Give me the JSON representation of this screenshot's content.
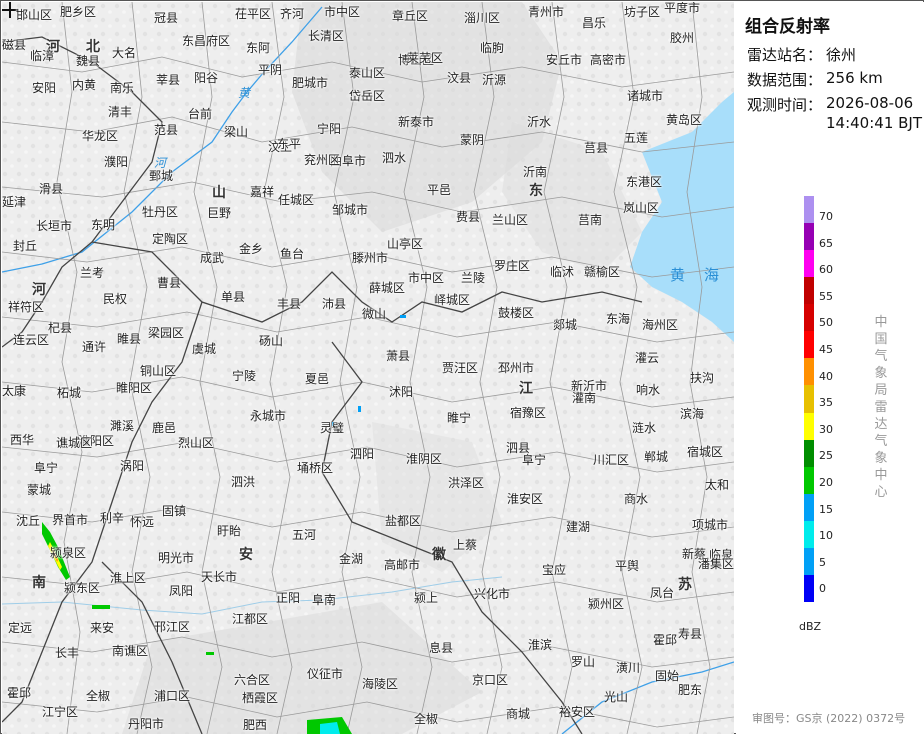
{
  "panel": {
    "title": "组合反射率",
    "station_label": "雷达站名：",
    "station_value": "徐州",
    "range_label": "数据范围：",
    "range_value": "256 km",
    "time_label": "观测时间：",
    "time_date": "2026-08-06",
    "time_clock": "14:40:41 BJT",
    "organization": "中国气象局雷达气象中心",
    "unit": "dBZ",
    "review_number": "审图号：GS京 (2022) 0372号"
  },
  "legend": {
    "ticks": [
      "70",
      "65",
      "60",
      "55",
      "50",
      "45",
      "40",
      "35",
      "30",
      "25",
      "20",
      "15",
      "10",
      "5",
      "0"
    ],
    "colors": [
      "#ad90f0",
      "#9600b4",
      "#ff00f0",
      "#c00000",
      "#d60000",
      "#ff0000",
      "#ff9000",
      "#e7c000",
      "#ffff00",
      "#008e00",
      "#00c800",
      "#01a0f6",
      "#00ecec",
      "#01a0f6",
      "#0000f6"
    ]
  },
  "map": {
    "provinces": [
      "河",
      "北",
      "山",
      "东",
      "河",
      "南",
      "安",
      "徽",
      "江",
      "苏"
    ],
    "waters": [
      "黄",
      "河",
      "黄",
      "海"
    ],
    "places": [
      "邯山区",
      "肥乡区",
      "冠县",
      "茌平区",
      "齐河",
      "市中区",
      "章丘区",
      "淄川区",
      "青州市",
      "昌乐",
      "坊子区",
      "平度市",
      "磁县",
      "临漳",
      "魏县",
      "大名",
      "东昌府区",
      "东阿",
      "长清区",
      "博山区",
      "临朐",
      "安丘市",
      "高密市",
      "胶州",
      "安阳",
      "内黄",
      "南乐",
      "莘县",
      "阳谷",
      "平阴",
      "肥城市",
      "泰山区",
      "莱芜区",
      "沂源",
      "诸城市",
      "清丰",
      "台前",
      "岱岳区",
      "新泰市",
      "沂水",
      "黄岛区",
      "汶县",
      "华龙区",
      "范县",
      "梁山",
      "汶上",
      "宁阳",
      "曲阜市",
      "泗水",
      "蒙阴",
      "莒县",
      "五莲",
      "滑县",
      "濮阳",
      "东平",
      "兖州区",
      "平邑",
      "沂南",
      "东港区",
      "鄄城",
      "嘉祥",
      "任城区",
      "邹城市",
      "费县",
      "莒南",
      "延津",
      "长垣市",
      "东明",
      "牡丹区",
      "巨野",
      "山亭区",
      "兰山区",
      "岚山区",
      "封丘",
      "定陶区",
      "成武",
      "金乡",
      "鱼台",
      "滕州市",
      "罗庄区",
      "临沭",
      "赣榆区",
      "兰考",
      "曹县",
      "单县",
      "丰县",
      "沛县",
      "薛城区",
      "市中区",
      "峄城区",
      "兰陵",
      "祥符区",
      "民权",
      "微山",
      "杞县",
      "梁园区",
      "虞城",
      "砀山",
      "鼓楼区",
      "郯城",
      "东海",
      "海州区",
      "连云区",
      "通许",
      "睢县",
      "宁陵",
      "夏邑",
      "萧县",
      "贾汪区",
      "邳州市",
      "新沂市",
      "灌云",
      "太康",
      "柘城",
      "睢阳区",
      "铜山区",
      "沭阳",
      "灌南",
      "响水",
      "扶沟",
      "淮阳区",
      "鹿邑",
      "永城市",
      "睢宁",
      "宿豫区",
      "涟水",
      "滨海",
      "西华",
      "谯城区",
      "濉溪",
      "烈山区",
      "埇桥区",
      "灵璧",
      "泗阳",
      "淮阴区",
      "阜宁",
      "川汇区",
      "郸城",
      "宿城区",
      "阜宁",
      "涡阳",
      "泗县",
      "泗洪",
      "洪泽区",
      "淮安区",
      "建湖",
      "商水",
      "太和",
      "蒙城",
      "固镇",
      "五河",
      "盐都区",
      "上蔡",
      "项城市",
      "沈丘",
      "界首市",
      "利辛",
      "怀远",
      "盱眙",
      "金湖",
      "宝应",
      "平舆",
      "新蔡",
      "临泉",
      "颍泉区",
      "颍东区",
      "淮上区",
      "明光市",
      "天长市",
      "高邮市",
      "兴化市",
      "颍州区",
      "凤台",
      "潘集区",
      "凤阳",
      "正阳",
      "阜南",
      "颍上",
      "定远",
      "来安",
      "邗江区",
      "江都区",
      "息县",
      "淮滨",
      "霍邱",
      "寿县",
      "长丰",
      "南谯区",
      "六合区",
      "仪征市",
      "海陵区",
      "罗山",
      "潢川",
      "固始",
      "霍邱",
      "全椒",
      "浦口区",
      "栖霞区",
      "京口区",
      "光山",
      "商城",
      "裕安区",
      "肥东",
      "江宁区",
      "丹阳市",
      "肥西",
      "全椒"
    ]
  }
}
